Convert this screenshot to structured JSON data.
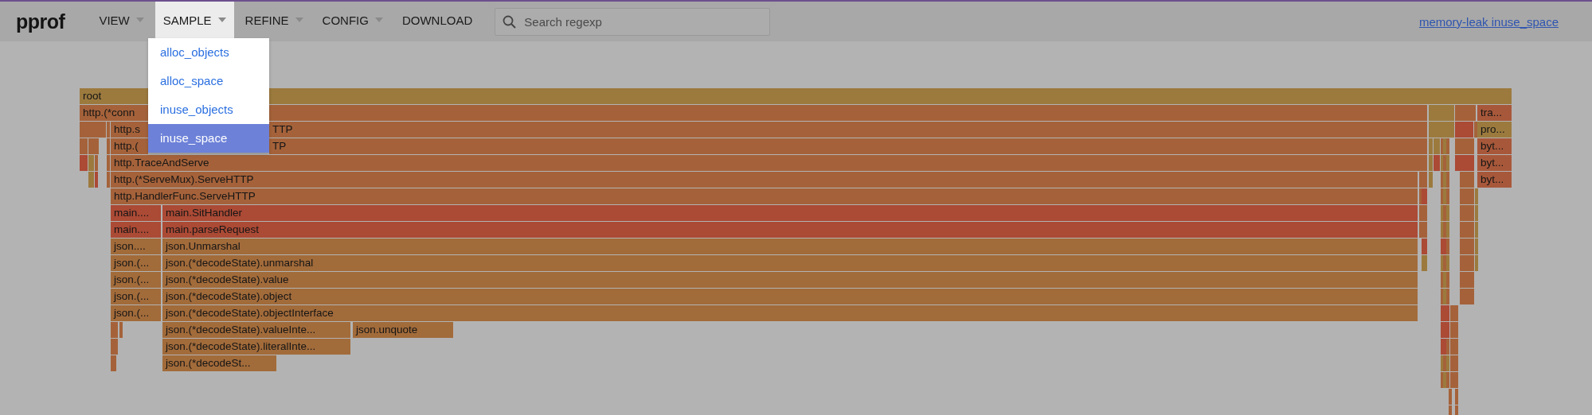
{
  "header": {
    "logo": "pprof",
    "nav": [
      {
        "label": "VIEW",
        "dropdown": true,
        "open": false
      },
      {
        "label": "SAMPLE",
        "dropdown": true,
        "open": true
      },
      {
        "label": "REFINE",
        "dropdown": true,
        "open": false
      },
      {
        "label": "CONFIG",
        "dropdown": true,
        "open": false
      },
      {
        "label": "DOWNLOAD",
        "dropdown": false,
        "open": false
      }
    ],
    "search": {
      "placeholder": "Search regexp"
    },
    "profile_link": "memory-leak inuse_space"
  },
  "sample_menu": {
    "items": [
      {
        "label": "alloc_objects",
        "selected": false
      },
      {
        "label": "alloc_space",
        "selected": false
      },
      {
        "label": "inuse_objects",
        "selected": false
      },
      {
        "label": "inuse_space",
        "selected": true
      }
    ]
  },
  "flame_graph": {
    "rows": [
      [
        {
          "label": "root",
          "color": "#9c7a3e"
        }
      ],
      [
        {
          "label": "http.(*conn",
          "color": "#a5623a"
        },
        {
          "label": "tra...",
          "color": "#a8583a"
        }
      ],
      [
        {
          "label": "http.s",
          "tail": "TTP",
          "color": "#a5623a"
        },
        {
          "label": "pro...",
          "color": "#9c7a3e"
        }
      ],
      [
        {
          "label": "http.(",
          "tail": "TP",
          "color": "#a5623a"
        },
        {
          "label": "byt...",
          "color": "#a8583a"
        }
      ],
      [
        {
          "label": "http.TraceAndServe",
          "color": "#a5623a"
        },
        {
          "label": "byt...",
          "color": "#a8583a"
        }
      ],
      [
        {
          "label": "http.(*ServeMux).ServeHTTP",
          "color": "#a5623a"
        },
        {
          "label": "byt...",
          "color": "#a8583a"
        }
      ],
      [
        {
          "label": "http.HandlerFunc.ServeHTTP",
          "color": "#a5623a"
        }
      ],
      [
        {
          "label": "main....",
          "color": "#ab4a35"
        },
        {
          "label": "main.SitHandler",
          "color": "#ab4a35"
        }
      ],
      [
        {
          "label": "main....",
          "color": "#ab4a35"
        },
        {
          "label": "main.parseRequest",
          "color": "#ab4a35"
        }
      ],
      [
        {
          "label": "json....",
          "color": "#a26b3a"
        },
        {
          "label": "json.Unmarshal",
          "color": "#a26b3a"
        }
      ],
      [
        {
          "label": "json.(...",
          "color": "#a26b3a"
        },
        {
          "label": "json.(*decodeState).unmarshal",
          "color": "#a26b3a"
        }
      ],
      [
        {
          "label": "json.(...",
          "color": "#a26b3a"
        },
        {
          "label": "json.(*decodeState).value",
          "color": "#a26b3a"
        }
      ],
      [
        {
          "label": "json.(...",
          "color": "#a26b3a"
        },
        {
          "label": "json.(*decodeState).object",
          "color": "#a26b3a"
        }
      ],
      [
        {
          "label": "json.(...",
          "color": "#a26b3a"
        },
        {
          "label": "json.(*decodeState).objectInterface",
          "color": "#a26b3a"
        }
      ],
      [
        {
          "label": "json.(*decodeState).valueInte...",
          "color": "#a26b3a"
        },
        {
          "label": "json.unquote",
          "color": "#a26b3a"
        }
      ],
      [
        {
          "label": "json.(*decodeState).literalInte...",
          "color": "#a26b3a"
        }
      ],
      [
        {
          "label": "json.(*decodeSt...",
          "color": "#a26b3a"
        }
      ]
    ]
  }
}
